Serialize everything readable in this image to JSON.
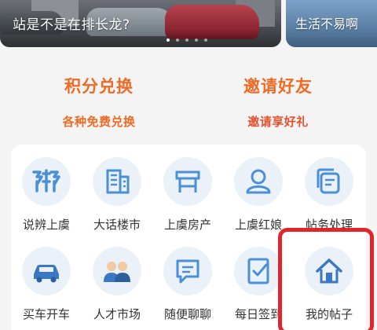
{
  "banner": {
    "slides": [
      {
        "caption": "站是不是在排长龙?"
      },
      {
        "caption": "生活不易啊"
      }
    ],
    "dot_count": 5,
    "active_dot": 0
  },
  "promos": [
    {
      "title": "积分兑换",
      "subtitle": "各种免费兑换"
    },
    {
      "title": "邀请好友",
      "subtitle": "邀请享好礼"
    }
  ],
  "grid": {
    "items": [
      {
        "label": "说辨上虞",
        "icon": "speech-icon"
      },
      {
        "label": "大话楼市",
        "icon": "building-icon"
      },
      {
        "label": "上虞房产",
        "icon": "house-sale-icon"
      },
      {
        "label": "上虞红娘",
        "icon": "person-icon"
      },
      {
        "label": "帖务处理",
        "icon": "document-stack-icon"
      },
      {
        "label": "买车开车",
        "icon": "car-icon"
      },
      {
        "label": "人才市场",
        "icon": "people-icon"
      },
      {
        "label": "随便聊聊",
        "icon": "chat-icon"
      },
      {
        "label": "每日签到",
        "icon": "checkin-icon"
      },
      {
        "label": "我的帖子",
        "icon": "home-icon"
      }
    ]
  },
  "colors": {
    "accent_orange": "#ef6a24",
    "accent_red": "#e8502d",
    "icon_blue": "#4a90d9",
    "icon_bg": "#eaf1f8",
    "highlight_red": "#e0262a"
  }
}
